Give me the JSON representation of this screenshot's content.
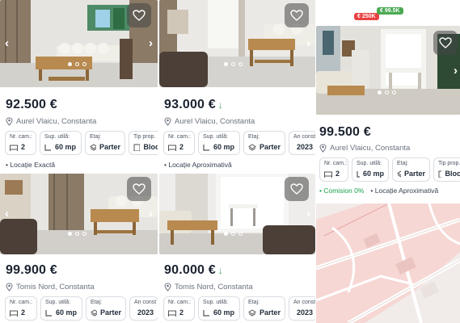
{
  "colors": {
    "accent": "#e94141",
    "green": "#4aa952",
    "map_red": "#f3b0b0"
  },
  "labels": {
    "rooms": "Nr. cam.:",
    "area": "Sup. utilă:",
    "floor": "Etaj:",
    "type": "Tip prop.",
    "year": "An const"
  },
  "listings": [
    {
      "price": "92.500 €",
      "arrow": "",
      "location": "Aurel Vlaicu, Constanta",
      "rooms": "2",
      "area": "60 mp",
      "floor": "Parter",
      "type": "Bloc",
      "year": "",
      "tags": [
        "• Locație Exactă"
      ]
    },
    {
      "price": "93.000 €",
      "arrow": "↓",
      "location": "Aurel Vlaicu, Constanta",
      "rooms": "2",
      "area": "60 mp",
      "floor": "Parter",
      "type": "",
      "year": "2023",
      "tags": [
        "• Locație Aproximativă"
      ]
    },
    {
      "price": "99.500 €",
      "arrow": "",
      "location": "Aurel Vlaicu, Constanta",
      "rooms": "2",
      "area": "60 mp",
      "floor": "Parter",
      "type": "Bloc",
      "year": "",
      "tags": [
        "• Comision 0%",
        "• Locație Aproximativă"
      ]
    },
    {
      "price": "99.900 €",
      "arrow": "",
      "location": "Tomis Nord, Constanta",
      "rooms": "2",
      "area": "60 mp",
      "floor": "Parter",
      "type": "",
      "year": "2023",
      "tags": []
    },
    {
      "price": "90.000 €",
      "arrow": "↓",
      "location": "Tomis Nord, Constanta",
      "rooms": "2",
      "area": "60 mp",
      "floor": "Parter",
      "type": "",
      "year": "2023",
      "tags": []
    }
  ],
  "map_pins": [
    {
      "label": "€ 250K",
      "color": "#e94141"
    },
    {
      "label": "€ 99.5K",
      "color": "#4aa952"
    }
  ]
}
